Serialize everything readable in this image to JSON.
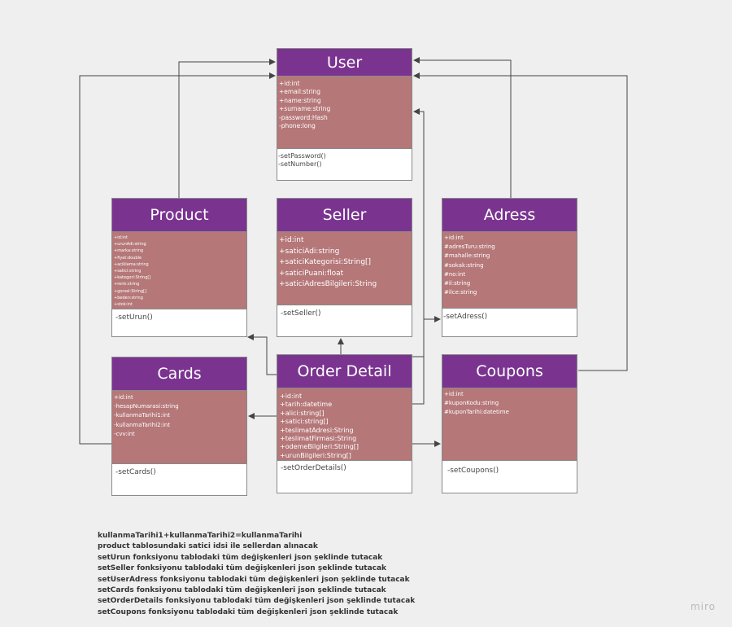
{
  "classes": {
    "user": {
      "name": "User",
      "attributes": [
        "+id:int",
        "+email:string",
        "+name:string",
        "+surname:string",
        "-password:Hash",
        "-phone:long"
      ],
      "methods": [
        "-setPassword()",
        "-setNumber()"
      ]
    },
    "product": {
      "name": "Product",
      "attributes": [
        "+id:int",
        "+urunAdi:string",
        "+marka:string",
        "+fiyat:double",
        "+aciklama:string",
        "+satici:string",
        "+kategori:String[]",
        "+renk:string",
        "+gorsel:String[]",
        "+beden:string",
        "+stok:int"
      ],
      "methods": [
        "-setUrun()"
      ]
    },
    "seller": {
      "name": "Seller",
      "attributes": [
        "+id:int",
        "+saticiAdi:string",
        "+saticiKategorisi:String[]",
        "+saticiPuani:float",
        "+saticiAdresBilgileri:String"
      ],
      "methods": [
        "-setSeller()"
      ]
    },
    "adress": {
      "name": "Adress",
      "attributes": [
        "+id:int",
        "#adresTuru:string",
        "#mahalle:string",
        "#sokak:string",
        "#no:int",
        "#il:string",
        "#ilce:string"
      ],
      "methods": [
        "-setAdress()"
      ]
    },
    "cards": {
      "name": "Cards",
      "attributes": [
        "+id:int",
        "-hesapNumarasi:string",
        "-kullanmaTarihi1:int",
        "-kullanmaTarihi2:int",
        "-cvv:int"
      ],
      "methods": [
        "-setCards()"
      ]
    },
    "order_detail": {
      "name": "Order Detail",
      "attributes": [
        "+id:int",
        "+tarih:datetime",
        "+alici:string[]",
        "+satici:string[]",
        "+teslimatAdresi:String",
        "+teslimatFirmasi:String",
        "+odemeBilgileri:String[]",
        "+urunBilgileri:String[]"
      ],
      "methods": [
        "-setOrderDetails()"
      ]
    },
    "coupons": {
      "name": "Coupons",
      "attributes": [
        "+id:int",
        "#kuponKodu:string",
        "#kuponTarihi:datetime"
      ],
      "methods": [
        "-setCoupons()"
      ]
    }
  },
  "notes": [
    "kullanmaTarihi1+kullanmaTarihi2=kullanmaTarihi",
    "product tablosundaki satici idsi ile sellerdan alınacak",
    "setUrun fonksiyonu tablodaki tüm değişkenleri json şeklinde tutacak",
    "setSeller fonksiyonu tablodaki tüm değişkenleri json şeklinde tutacak",
    "setUserAdress fonksiyonu tablodaki tüm değişkenleri json şeklinde tutacak",
    "setCards fonksiyonu tablodaki tüm değişkenleri json şeklinde tutacak",
    "setOrderDetails fonksiyonu tablodaki tüm değişkenleri json şeklinde tutacak",
    "setCoupons fonksiyonu tablodaki tüm değişkenleri json şeklinde tutacak"
  ],
  "watermark": "miro",
  "colors": {
    "header": "#7a3490",
    "attributes": "#b57778",
    "methods": "#ffffff",
    "background": "#efefef",
    "connector": "#444444"
  }
}
